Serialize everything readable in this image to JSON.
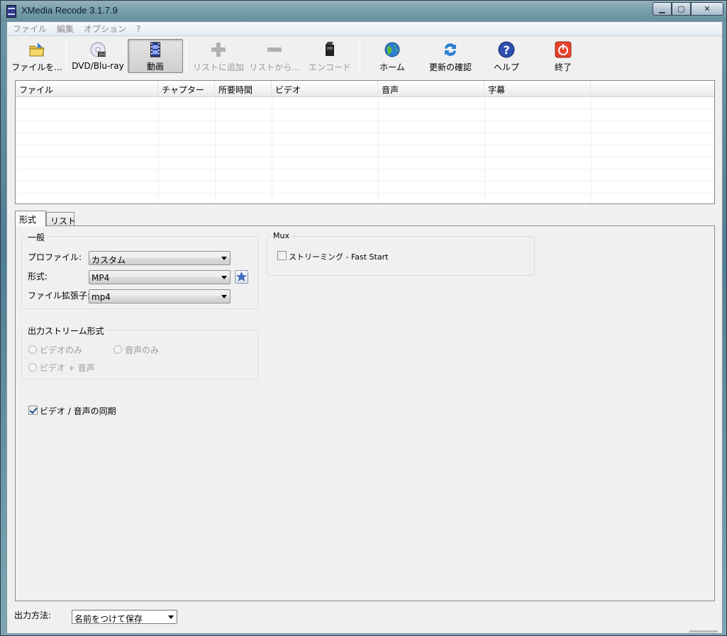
{
  "window": {
    "title": "XMedia Recode 3.1.7.9"
  },
  "menu": [
    "ファイル",
    "編集",
    "オプション",
    "?"
  ],
  "toolbar": [
    {
      "label": "ファイルを...",
      "icon": "open-folder-icon",
      "state": "normal"
    },
    {
      "label": "DVD/Blu-ray",
      "icon": "dvd-disc-icon",
      "state": "normal"
    },
    {
      "label": "動画",
      "icon": "film-strip-icon",
      "state": "active"
    },
    {
      "label": "リストに追加",
      "icon": "plus-icon",
      "state": "disabled"
    },
    {
      "label": "リストから...",
      "icon": "minus-icon",
      "state": "disabled"
    },
    {
      "label": "エンコード",
      "icon": "encode-icon",
      "state": "disabled"
    },
    {
      "label": "ホーム",
      "icon": "globe-icon",
      "state": "normal"
    },
    {
      "label": "更新の確認",
      "icon": "refresh-icon",
      "state": "normal"
    },
    {
      "label": "ヘルプ",
      "icon": "help-icon",
      "state": "normal"
    },
    {
      "label": "終了",
      "icon": "power-icon",
      "state": "normal"
    }
  ],
  "filelist": {
    "columns": [
      "ファイル",
      "チャプター",
      "所要時間",
      "ビデオ",
      "音声",
      "字幕"
    ],
    "rows": []
  },
  "tabs": [
    "形式",
    "リスト"
  ],
  "general": {
    "title": "一般",
    "profile_label": "プロファイル:",
    "profile_value": "カスタム",
    "format_label": "形式:",
    "format_value": "MP4",
    "ext_label": "ファイル拡張子:",
    "ext_value": "mp4"
  },
  "mux": {
    "title": "Mux",
    "streaming_label": "ストリーミング - Fast Start",
    "streaming_checked": false
  },
  "output_stream": {
    "title": "出力ストリーム形式",
    "video_only": "ビデオのみ",
    "audio_only": "音声のみ",
    "video_audio": "ビデオ + 音声"
  },
  "sync": {
    "label": "ビデオ / 音声の同期",
    "checked": true
  },
  "output": {
    "label": "出力方法:",
    "value": "名前をつけて保存"
  },
  "colors": {
    "accent": "#1f4a8a",
    "disabled": "#9a9a9a",
    "panel": "#f0f0f0"
  }
}
